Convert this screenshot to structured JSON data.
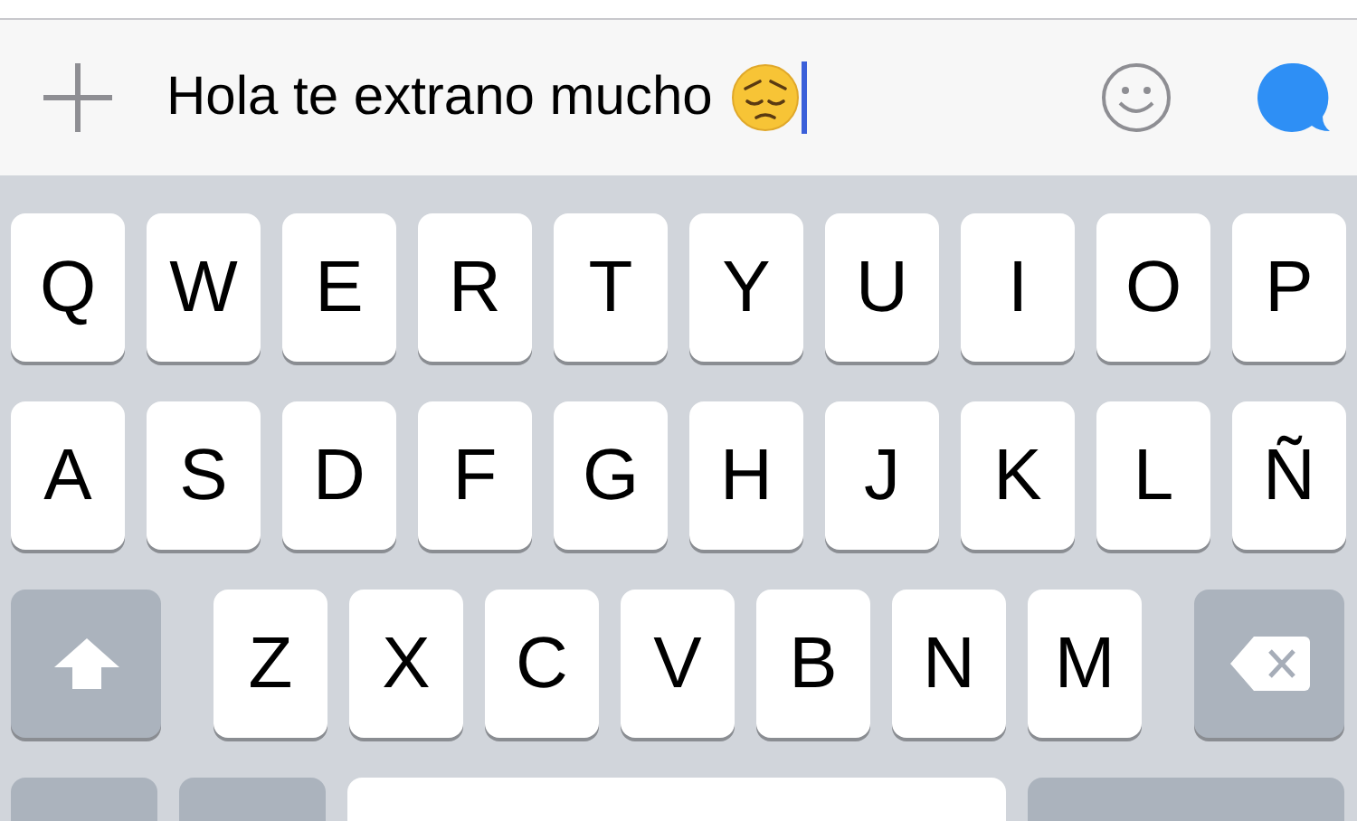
{
  "message_bar": {
    "value": "Hola te extrano mucho",
    "cursor": true
  },
  "keyboard": {
    "rows": [
      {
        "keys": [
          {
            "kind": "letter",
            "label": "Q"
          },
          {
            "kind": "letter",
            "label": "W"
          },
          {
            "kind": "letter",
            "label": "E"
          },
          {
            "kind": "letter",
            "label": "R"
          },
          {
            "kind": "letter",
            "label": "T"
          },
          {
            "kind": "letter",
            "label": "Y"
          },
          {
            "kind": "letter",
            "label": "U"
          },
          {
            "kind": "letter",
            "label": "I"
          },
          {
            "kind": "letter",
            "label": "O"
          },
          {
            "kind": "letter",
            "label": "P"
          }
        ]
      },
      {
        "keys": [
          {
            "kind": "letter",
            "label": "A"
          },
          {
            "kind": "letter",
            "label": "S"
          },
          {
            "kind": "letter",
            "label": "D"
          },
          {
            "kind": "letter",
            "label": "F"
          },
          {
            "kind": "letter",
            "label": "G"
          },
          {
            "kind": "letter",
            "label": "H"
          },
          {
            "kind": "letter",
            "label": "J"
          },
          {
            "kind": "letter",
            "label": "K"
          },
          {
            "kind": "letter",
            "label": "L"
          },
          {
            "kind": "letter",
            "label": "Ñ"
          }
        ]
      },
      {
        "keys": [
          {
            "kind": "shift"
          },
          {
            "kind": "letter",
            "label": "Z"
          },
          {
            "kind": "letter",
            "label": "X"
          },
          {
            "kind": "letter",
            "label": "C"
          },
          {
            "kind": "letter",
            "label": "V"
          },
          {
            "kind": "letter",
            "label": "B"
          },
          {
            "kind": "letter",
            "label": "N"
          },
          {
            "kind": "letter",
            "label": "M"
          },
          {
            "kind": "delete"
          }
        ]
      },
      {
        "keys": [
          {
            "kind": "small"
          },
          {
            "kind": "small"
          },
          {
            "kind": "space"
          },
          {
            "kind": "wide"
          }
        ]
      }
    ]
  }
}
